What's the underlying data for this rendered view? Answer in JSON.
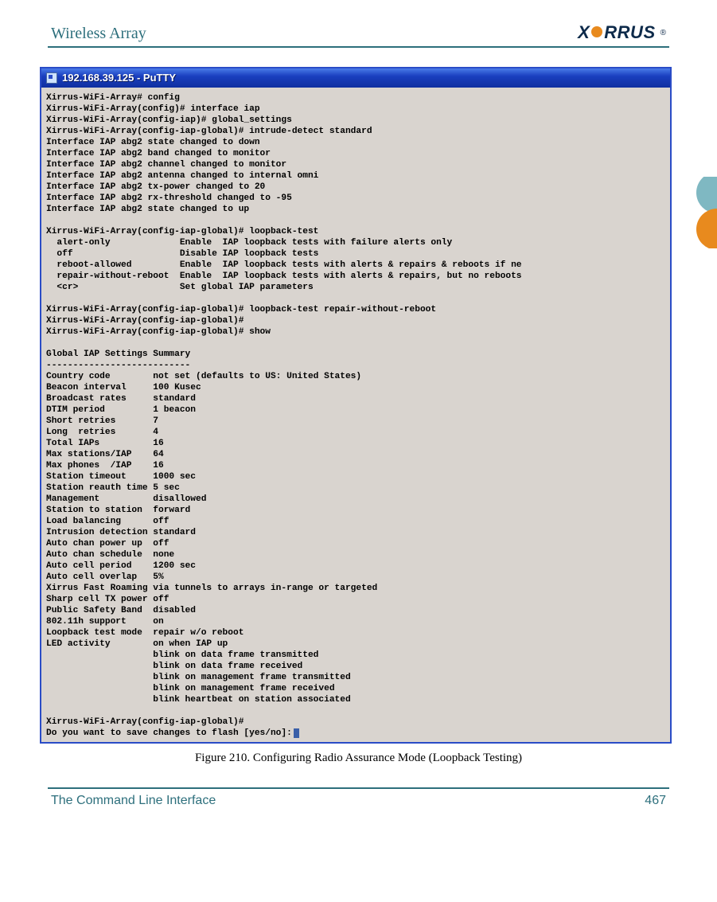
{
  "header": {
    "title": "Wireless Array",
    "brand_left": "X",
    "brand_right": "RRUS"
  },
  "terminal": {
    "title": "192.168.39.125 - PuTTY",
    "lines": [
      "Xirrus-WiFi-Array# config",
      "Xirrus-WiFi-Array(config)# interface iap",
      "Xirrus-WiFi-Array(config-iap)# global_settings",
      "Xirrus-WiFi-Array(config-iap-global)# intrude-detect standard",
      "Interface IAP abg2 state changed to down",
      "Interface IAP abg2 band changed to monitor",
      "Interface IAP abg2 channel changed to monitor",
      "Interface IAP abg2 antenna changed to internal omni",
      "Interface IAP abg2 tx-power changed to 20",
      "Interface IAP abg2 rx-threshold changed to -95",
      "Interface IAP abg2 state changed to up",
      "",
      "Xirrus-WiFi-Array(config-iap-global)# loopback-test",
      "  alert-only             Enable  IAP loopback tests with failure alerts only",
      "  off                    Disable IAP loopback tests",
      "  reboot-allowed         Enable  IAP loopback tests with alerts & repairs & reboots if ne",
      "  repair-without-reboot  Enable  IAP loopback tests with alerts & repairs, but no reboots",
      "  <cr>                   Set global IAP parameters",
      "",
      "Xirrus-WiFi-Array(config-iap-global)# loopback-test repair-without-reboot",
      "Xirrus-WiFi-Array(config-iap-global)#",
      "Xirrus-WiFi-Array(config-iap-global)# show",
      "",
      "Global IAP Settings Summary",
      "---------------------------",
      "Country code        not set (defaults to US: United States)",
      "Beacon interval     100 Kusec",
      "Broadcast rates     standard",
      "DTIM period         1 beacon",
      "Short retries       7",
      "Long  retries       4",
      "Total IAPs          16",
      "Max stations/IAP    64",
      "Max phones  /IAP    16",
      "Station timeout     1000 sec",
      "Station reauth time 5 sec",
      "Management          disallowed",
      "Station to station  forward",
      "Load balancing      off",
      "Intrusion detection standard",
      "Auto chan power up  off",
      "Auto chan schedule  none",
      "Auto cell period    1200 sec",
      "Auto cell overlap   5%",
      "Xirrus Fast Roaming via tunnels to arrays in-range or targeted",
      "Sharp cell TX power off",
      "Public Safety Band  disabled",
      "802.11h support     on",
      "Loopback test mode  repair w/o reboot",
      "LED activity        on when IAP up",
      "                    blink on data frame transmitted",
      "                    blink on data frame received",
      "                    blink on management frame transmitted",
      "                    blink on management frame received",
      "                    blink heartbeat on station associated",
      "",
      "Xirrus-WiFi-Array(config-iap-global)#",
      "Do you want to save changes to flash [yes/no]:"
    ]
  },
  "figure": {
    "caption": "Figure 210. Configuring Radio Assurance Mode (Loopback Testing)"
  },
  "footer": {
    "section": "The Command Line Interface",
    "page": "467"
  }
}
